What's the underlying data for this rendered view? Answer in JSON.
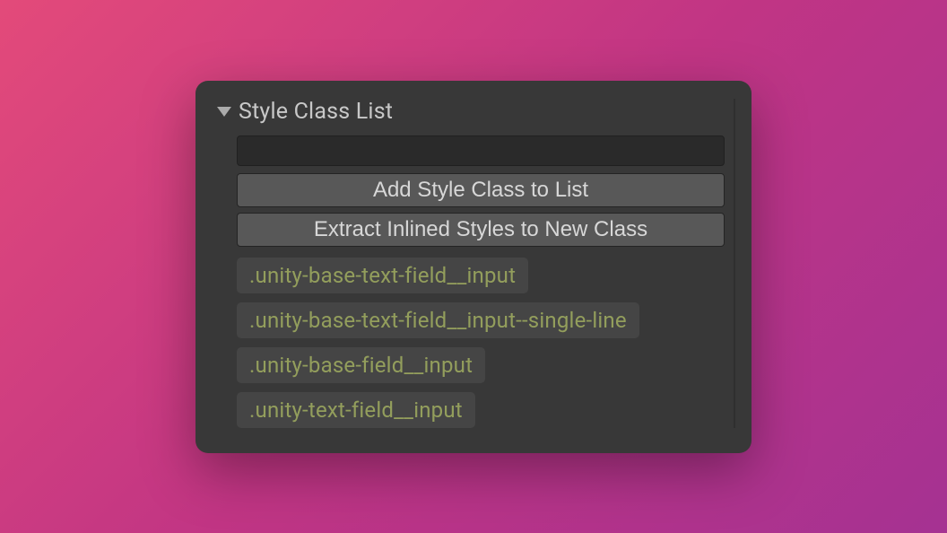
{
  "section": {
    "title": "Style Class List"
  },
  "input": {
    "value": "",
    "placeholder": ""
  },
  "buttons": {
    "add": "Add Style Class to List",
    "extract": "Extract Inlined Styles to New Class"
  },
  "classes": [
    ".unity-base-text-field__input",
    ".unity-base-text-field__input--single-line",
    ".unity-base-field__input",
    ".unity-text-field__input"
  ]
}
